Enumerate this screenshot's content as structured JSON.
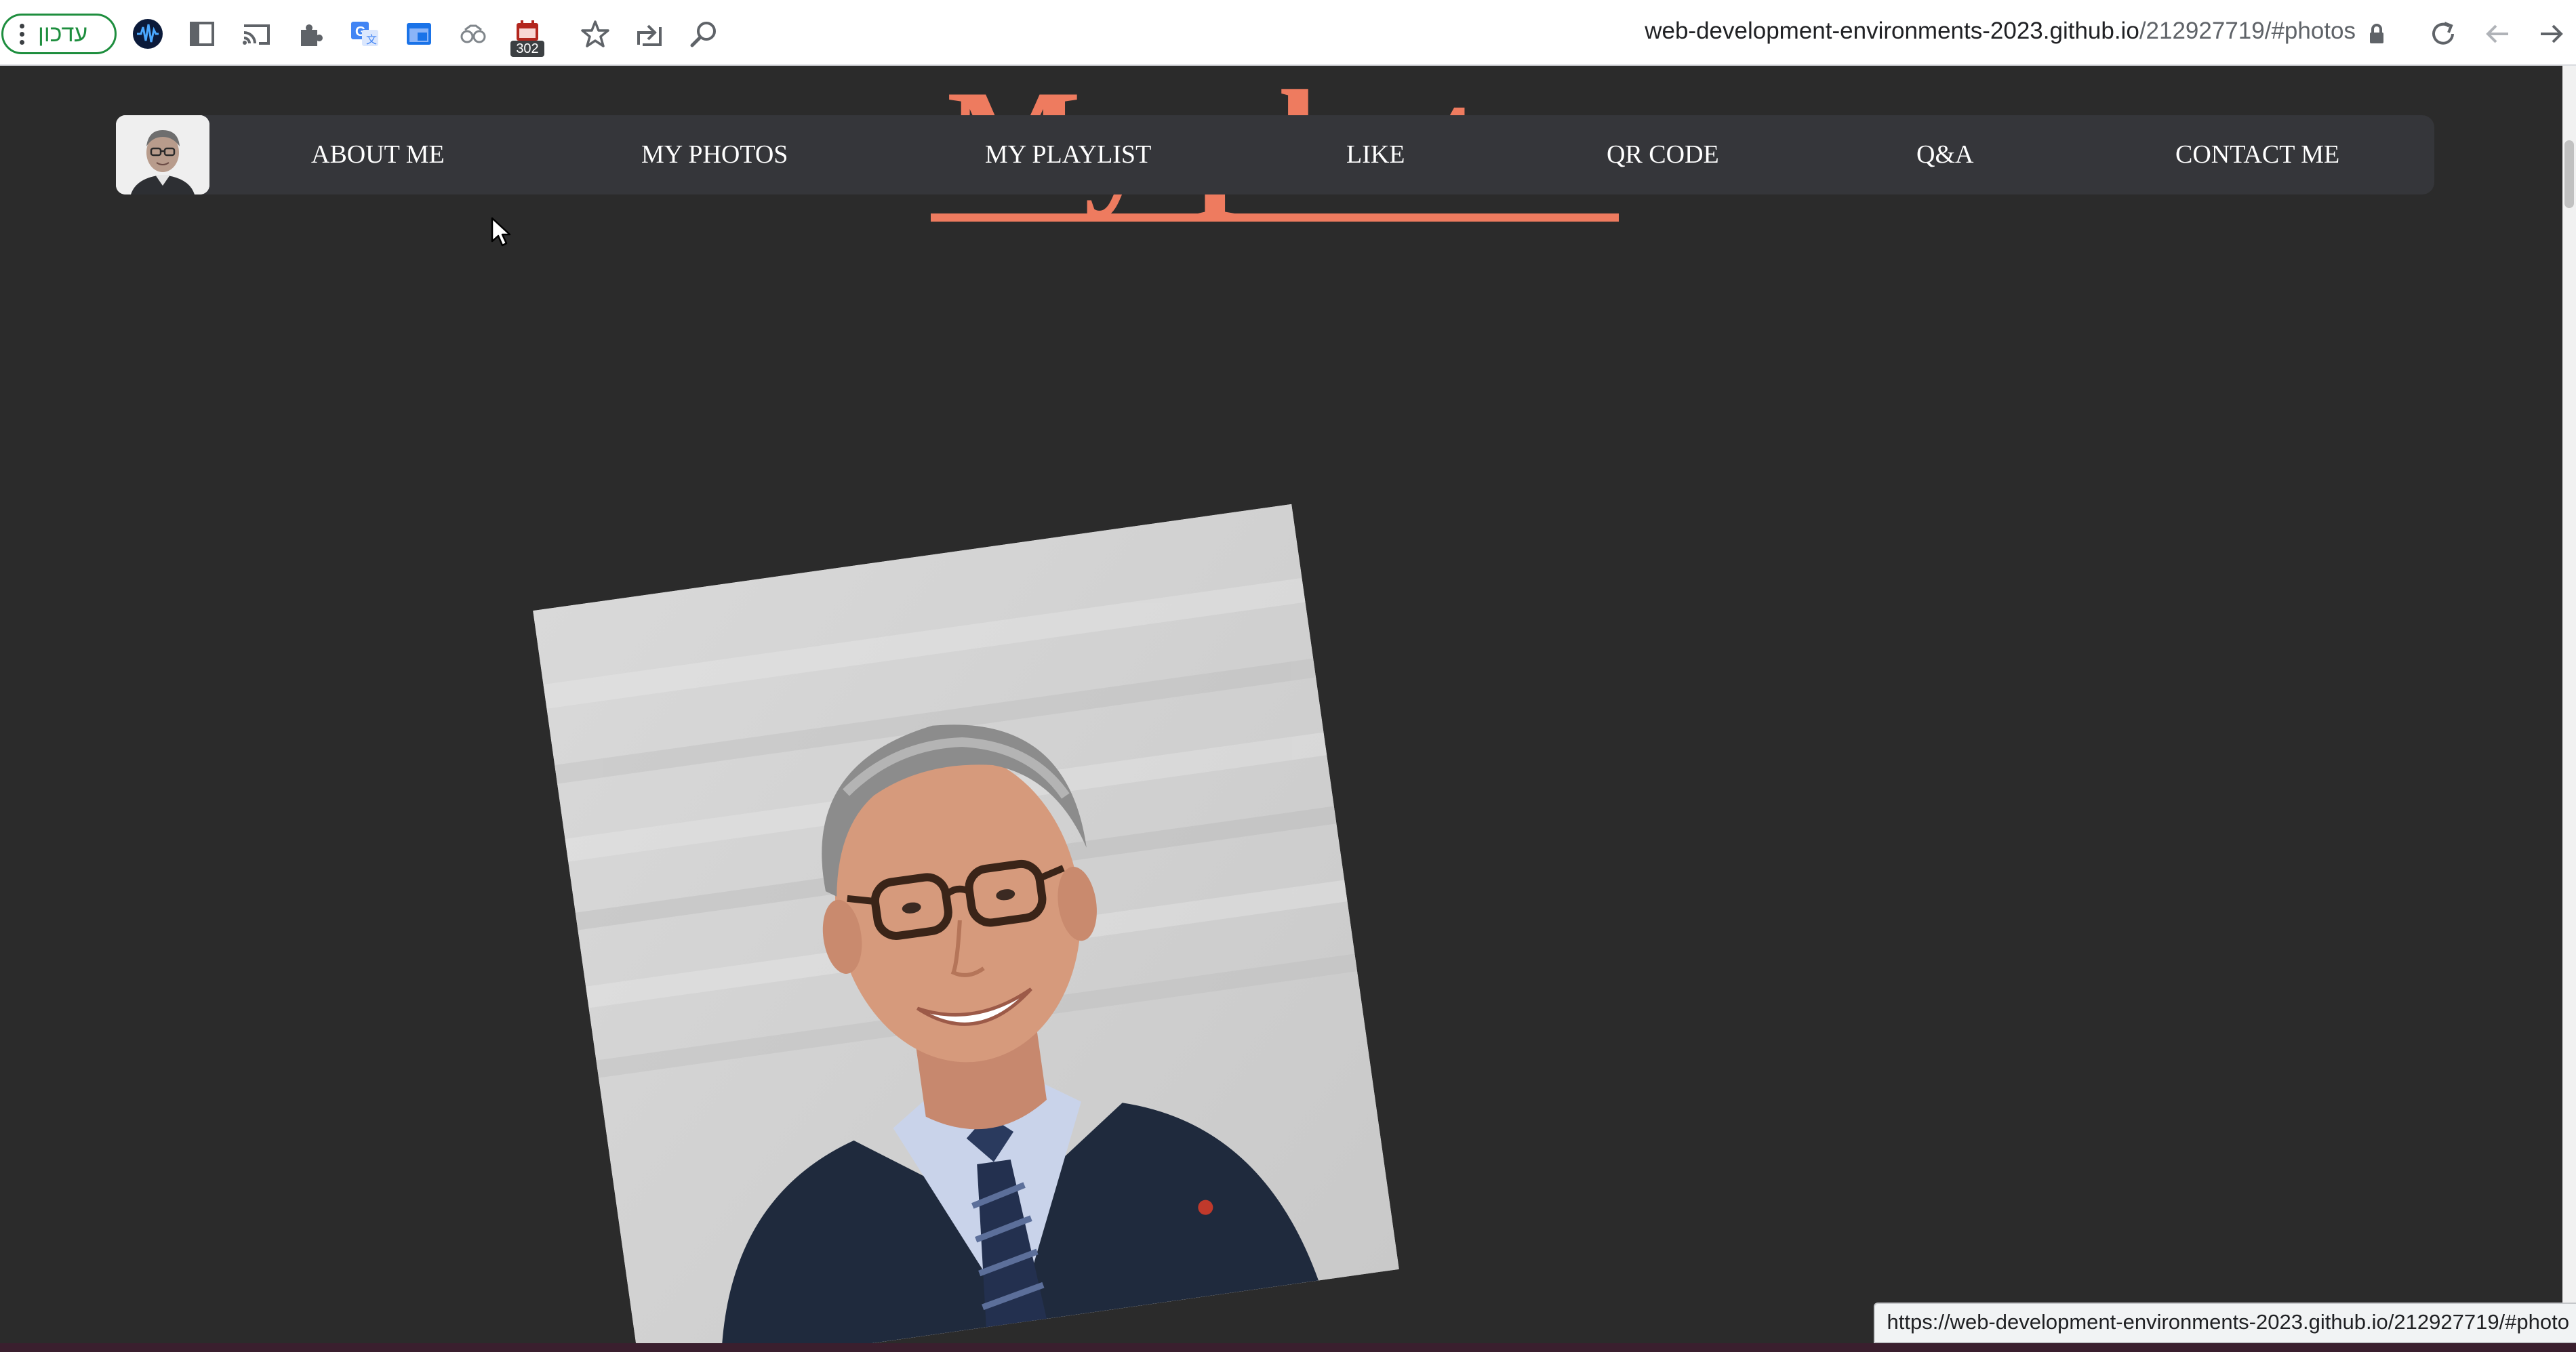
{
  "browser": {
    "update_label": "עדכון",
    "url_domain": "web-development-environments-2023.github.io",
    "url_path": "/212927719/#photos",
    "extension_badge": "302",
    "icons": [
      "menu-dots-icon",
      "extension-wave-icon",
      "side-panel-icon",
      "cast-icon",
      "puzzle-extensions-icon",
      "translate-icon",
      "window-icon",
      "glasses-icon",
      "calendar-extension-icon",
      "star-bookmark-icon",
      "share-icon",
      "zoom-icon",
      "lock-icon",
      "reload-icon",
      "back-icon",
      "forward-icon"
    ]
  },
  "site": {
    "nav": {
      "items": [
        {
          "label": "ABOUT ME"
        },
        {
          "label": "MY PHOTOS"
        },
        {
          "label": "MY PLAYLIST"
        },
        {
          "label": "LIKE"
        },
        {
          "label": "QR CODE"
        },
        {
          "label": "Q&A"
        },
        {
          "label": "CONTACT ME"
        }
      ]
    },
    "section_title": "My photos",
    "accent_color": "#ee7b5f",
    "background_color": "#2b2b2b",
    "nav_color": "#35363a"
  },
  "status_bar": {
    "hover_url": "https://web-development-environments-2023.github.io/212927719/#photo"
  }
}
